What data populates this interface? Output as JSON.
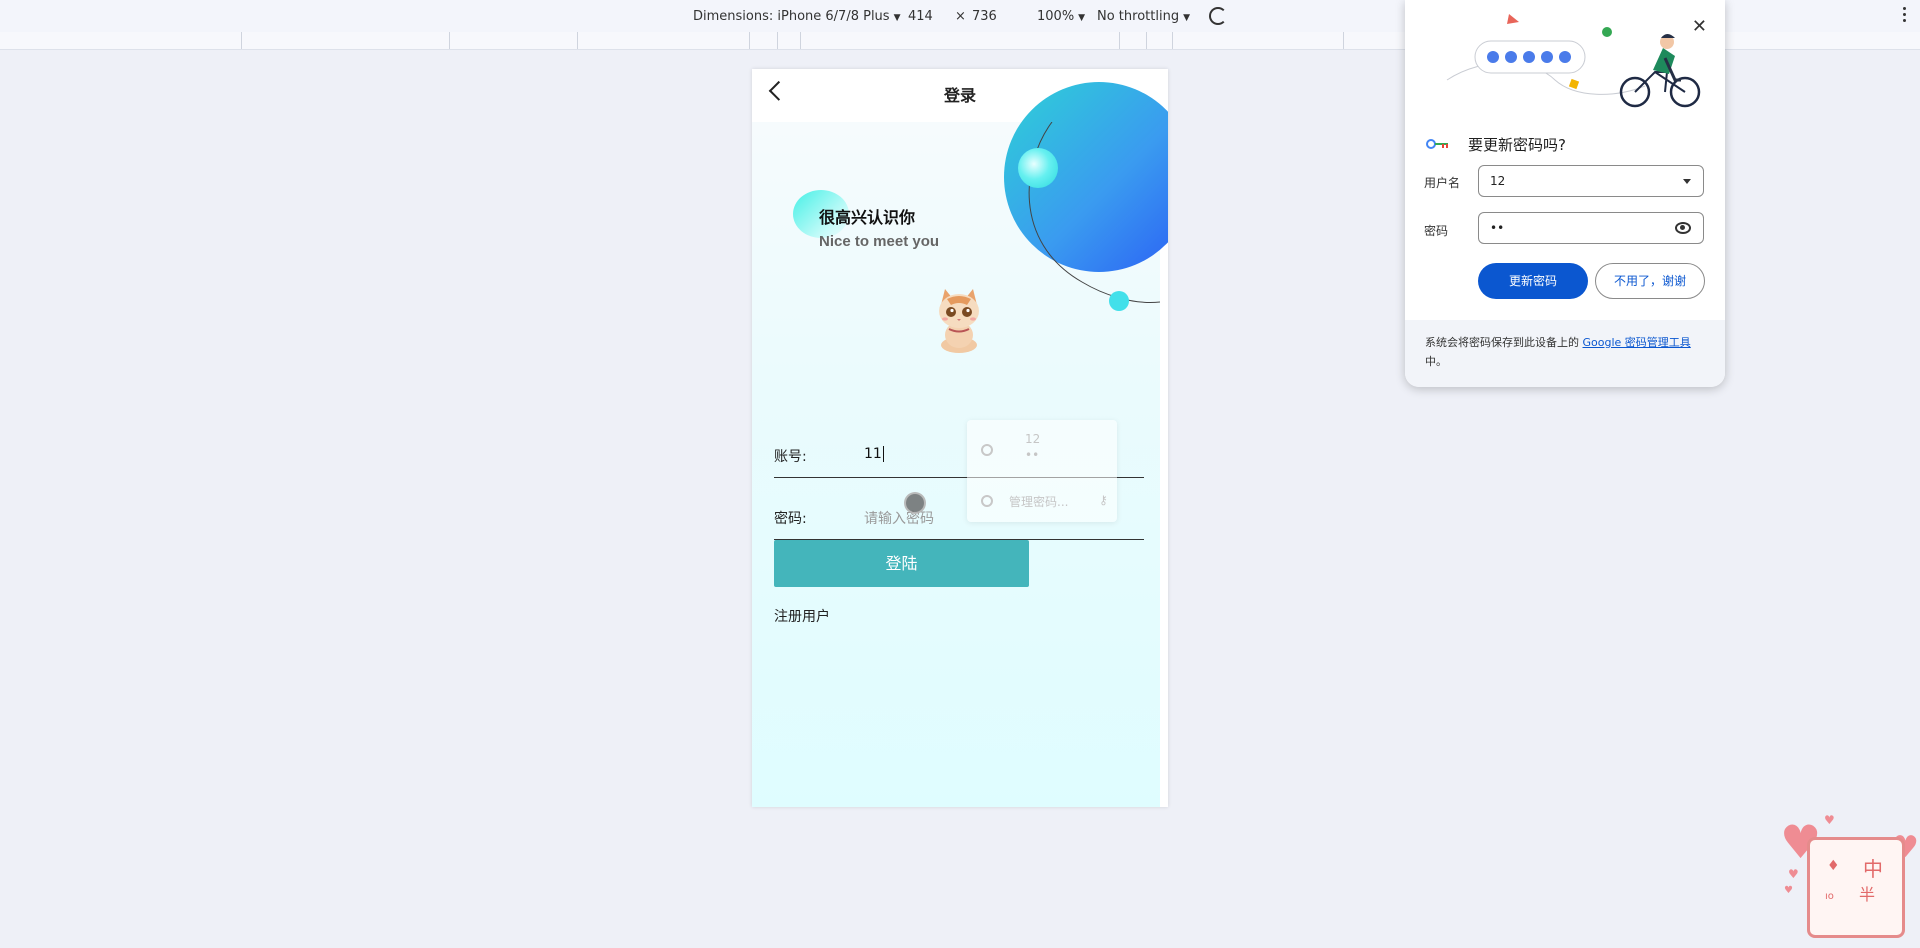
{
  "devtools": {
    "device_label": "Dimensions: iPhone 6/7/8 Plus",
    "width": "414",
    "times": "×",
    "height": "736",
    "zoom": "100%",
    "throttle": "No throttling"
  },
  "page": {
    "nav_title": "登录",
    "greeting_cn": "很高兴认识你",
    "greeting_en": "Nice to meet you",
    "account_label": "账号:",
    "account_value": "11",
    "password_label": "密码:",
    "password_placeholder": "请输入密码",
    "login_button": "登陆",
    "register_link": "注册用户"
  },
  "autofill": {
    "suggest_user": "12",
    "suggest_pass": "••",
    "manage": "管理密码..."
  },
  "password_bubble": {
    "question": "要更新密码吗?",
    "username_label": "用户名",
    "username_value": "12",
    "password_label": "密码",
    "password_value": "••",
    "update_button": "更新密码",
    "decline_button": "不用了，谢谢",
    "footer_prefix": "系统会将密码保存到此设备上的 ",
    "footer_link": "Google 密码管理工具",
    "footer_suffix": "中。",
    "close": "✕"
  },
  "widget": {
    "char_1": "中",
    "char_2": "半",
    "small": "ıo"
  },
  "colors": {
    "accent_button": "#44b5bb",
    "bubble_primary": "#0b57d0",
    "blob_gradient_start": "#2ed1d6",
    "blob_gradient_end": "#2a5df5"
  }
}
